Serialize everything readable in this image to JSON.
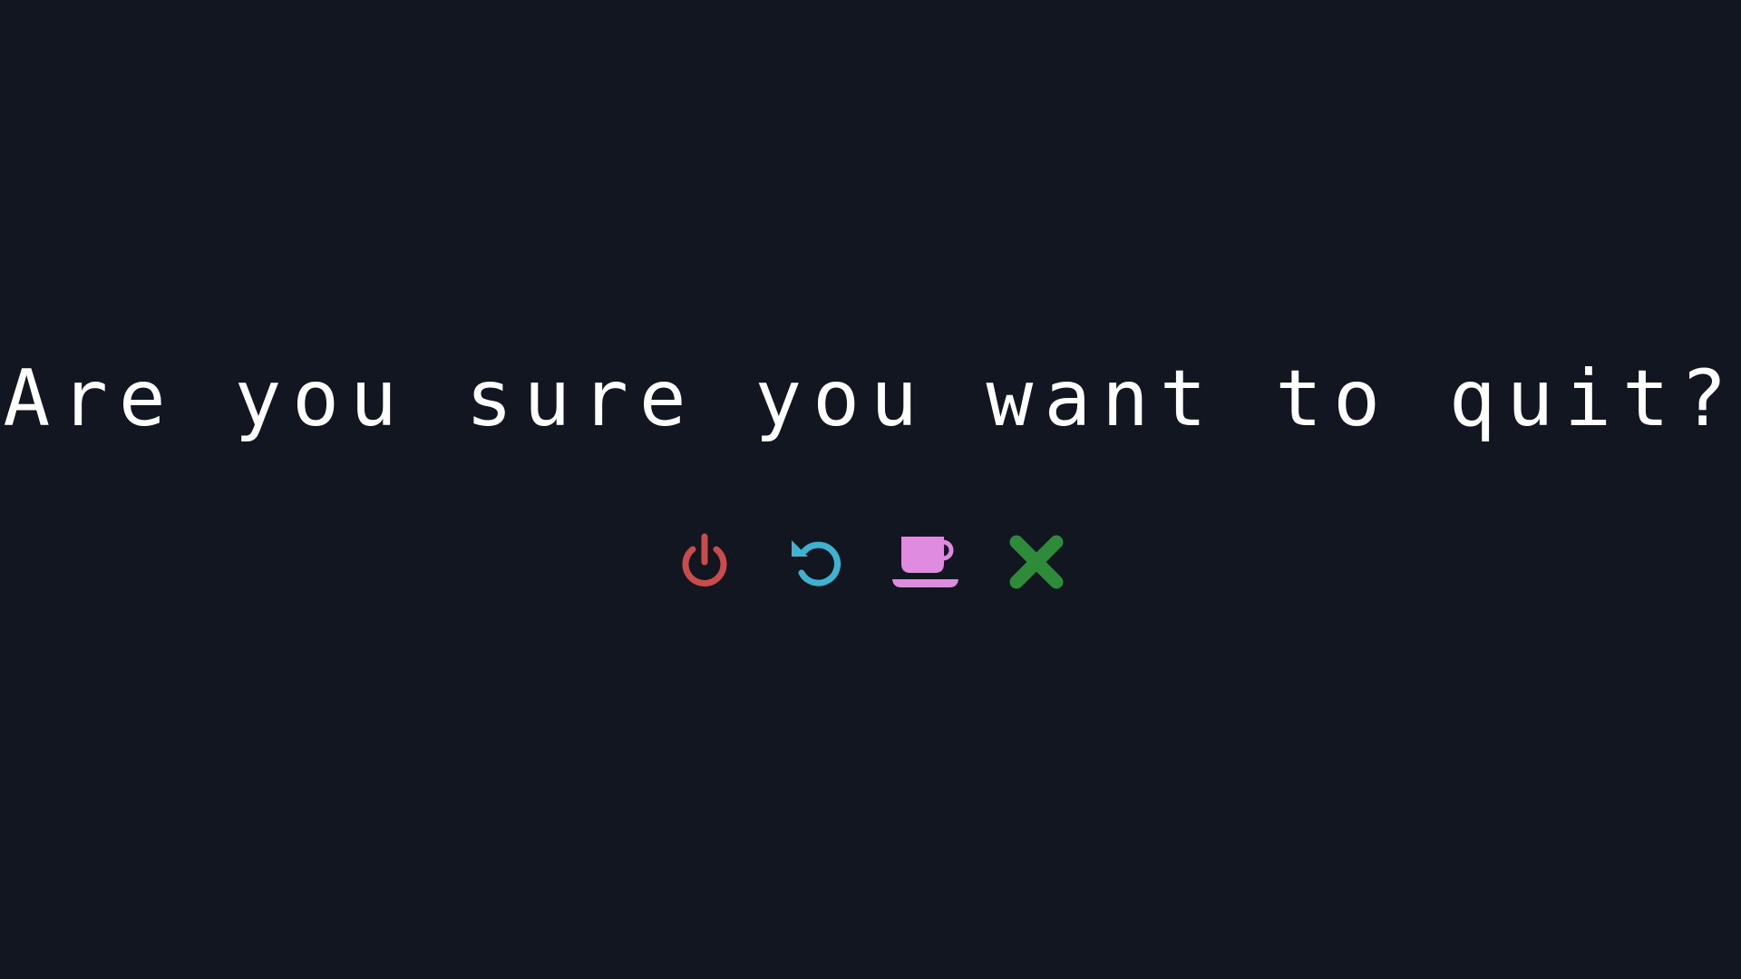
{
  "dialog": {
    "prompt": "Are you sure you want to quit?"
  },
  "options": [
    {
      "icon": "power-icon",
      "color": "#c94c4c"
    },
    {
      "icon": "restart-icon",
      "color": "#3fb2cf"
    },
    {
      "icon": "coffee-cup-icon",
      "color": "#de8be0"
    },
    {
      "icon": "close-x-icon",
      "color": "#2e8b3a"
    }
  ],
  "colors": {
    "background": "#121620",
    "text": "#ffffff"
  }
}
